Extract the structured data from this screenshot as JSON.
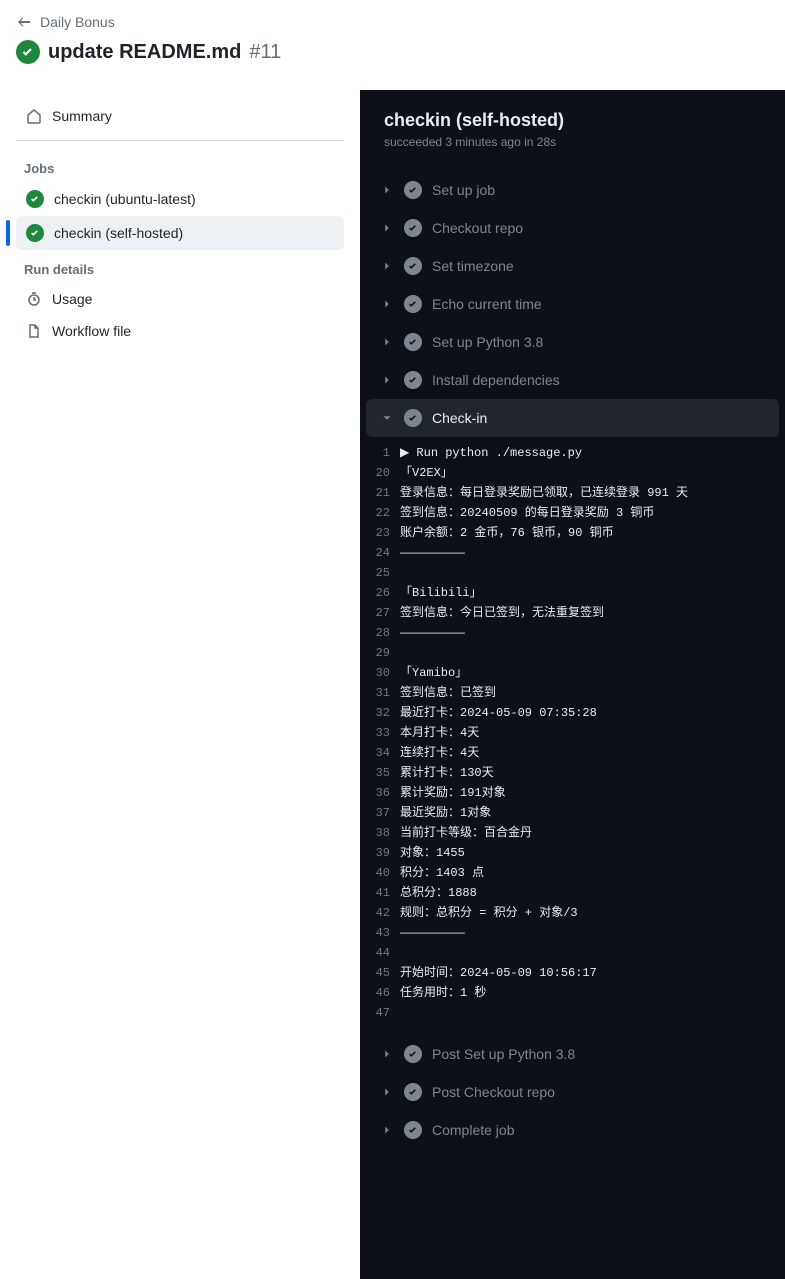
{
  "breadcrumb": "Daily Bonus",
  "title": "update README.md",
  "run_number": "#11",
  "sidebar": {
    "summary": "Summary",
    "jobs_label": "Jobs",
    "jobs": [
      {
        "label": "checkin (ubuntu-latest)"
      },
      {
        "label": "checkin (self-hosted)"
      }
    ],
    "run_details_label": "Run details",
    "usage": "Usage",
    "workflow_file": "Workflow file"
  },
  "job": {
    "title": "checkin (self-hosted)",
    "meta": "succeeded 3 minutes ago in 28s"
  },
  "steps": [
    {
      "label": "Set up job",
      "expanded": false
    },
    {
      "label": "Checkout repo",
      "expanded": false
    },
    {
      "label": "Set timezone",
      "expanded": false
    },
    {
      "label": "Echo current time",
      "expanded": false
    },
    {
      "label": "Set up Python 3.8",
      "expanded": false
    },
    {
      "label": "Install dependencies",
      "expanded": false
    },
    {
      "label": "Check-in",
      "expanded": true
    },
    {
      "label": "Post Set up Python 3.8",
      "expanded": false
    },
    {
      "label": "Post Checkout repo",
      "expanded": false
    },
    {
      "label": "Complete job",
      "expanded": false
    }
  ],
  "log": [
    {
      "n": "1",
      "t": "▶ Run python ./message.py",
      "cmd": true
    },
    {
      "n": "20",
      "t": "「V2EX」"
    },
    {
      "n": "21",
      "t": "登录信息：每日登录奖励已领取，已连续登录 991 天"
    },
    {
      "n": "22",
      "t": "签到信息：20240509 的每日登录奖励 3 铜币"
    },
    {
      "n": "23",
      "t": "账户余额：2 金币，76 银币，90 铜币"
    },
    {
      "n": "24",
      "t": "—————————"
    },
    {
      "n": "25",
      "t": ""
    },
    {
      "n": "26",
      "t": "「Bilibili」"
    },
    {
      "n": "27",
      "t": "签到信息：今日已签到，无法重复签到"
    },
    {
      "n": "28",
      "t": "—————————"
    },
    {
      "n": "29",
      "t": ""
    },
    {
      "n": "30",
      "t": "「Yamibo」"
    },
    {
      "n": "31",
      "t": "签到信息：已签到"
    },
    {
      "n": "32",
      "t": "最近打卡：2024-05-09 07:35:28"
    },
    {
      "n": "33",
      "t": "本月打卡：4天"
    },
    {
      "n": "34",
      "t": "连续打卡：4天"
    },
    {
      "n": "35",
      "t": "累计打卡：130天"
    },
    {
      "n": "36",
      "t": "累计奖励：191对象"
    },
    {
      "n": "37",
      "t": "最近奖励：1对象"
    },
    {
      "n": "38",
      "t": "当前打卡等级：百合金丹"
    },
    {
      "n": "39",
      "t": "对象：1455"
    },
    {
      "n": "40",
      "t": "积分：1403 点"
    },
    {
      "n": "41",
      "t": "总积分：1888"
    },
    {
      "n": "42",
      "t": "规则：总积分 = 积分 + 对象/3"
    },
    {
      "n": "43",
      "t": "—————————"
    },
    {
      "n": "44",
      "t": ""
    },
    {
      "n": "45",
      "t": "开始时间：2024-05-09 10:56:17"
    },
    {
      "n": "46",
      "t": "任务用时：1 秒"
    },
    {
      "n": "47",
      "t": ""
    }
  ]
}
